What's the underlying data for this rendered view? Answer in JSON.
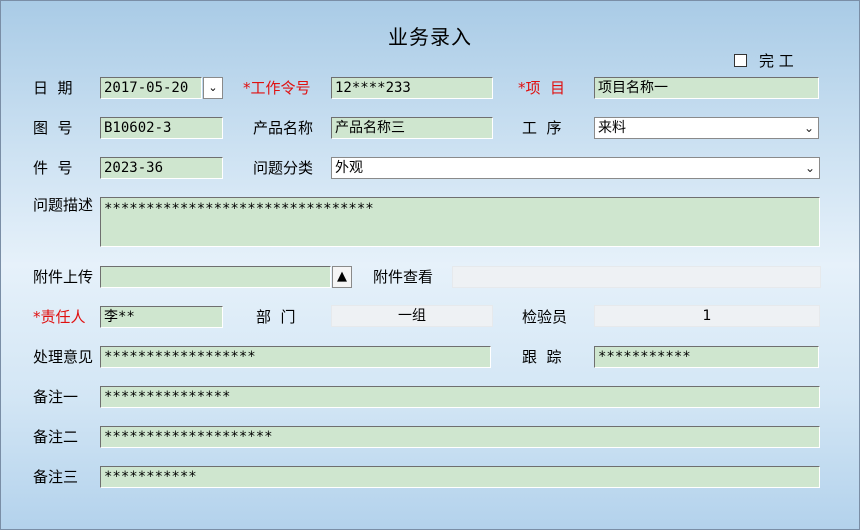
{
  "window": {
    "title": "业务录入"
  },
  "finish": {
    "label": "完 工",
    "checked": false
  },
  "form": {
    "date": {
      "label": "日  期",
      "value": "2017-05-20"
    },
    "work_order": {
      "label": "*工作令号",
      "value": "12****233"
    },
    "project": {
      "label": "*项  目",
      "value": "项目名称一"
    },
    "drawing_no": {
      "label": "图  号",
      "value": "B10602-3"
    },
    "product_name": {
      "label": "产品名称",
      "value": "产品名称三"
    },
    "process": {
      "label": "工  序",
      "value": "来料"
    },
    "part_no": {
      "label": "件  号",
      "value": "2023-36"
    },
    "issue_type": {
      "label": "问题分类",
      "value": "外观"
    },
    "issue_desc": {
      "label": "问题描述",
      "value": "********************************"
    },
    "attach_upload": {
      "label": "附件上传",
      "value": ""
    },
    "attach_view": {
      "label": "附件查看",
      "value": ""
    },
    "owner": {
      "label": "*责任人",
      "value": "李**"
    },
    "department": {
      "label": "部  门",
      "value": "一组"
    },
    "inspector": {
      "label": "检验员",
      "value": "1"
    },
    "opinion": {
      "label": "处理意见",
      "value": "******************"
    },
    "tracking": {
      "label": "跟  踪",
      "value": "***********"
    },
    "note1": {
      "label": "备注一",
      "value": "***************"
    },
    "note2": {
      "label": "备注二",
      "value": "********************"
    },
    "note3": {
      "label": "备注三",
      "value": "***********"
    }
  },
  "icons": {
    "spinner": "date-spinner-icon",
    "dropdown": "chevron-down-icon",
    "upload": "triangle-up-icon",
    "checkbox": "checkbox-icon"
  }
}
